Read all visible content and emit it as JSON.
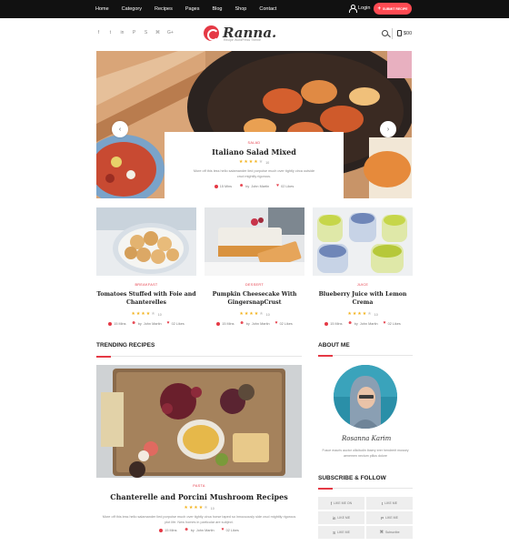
{
  "nav": {
    "items": [
      "Home",
      "Category",
      "Recipes",
      "Pages",
      "Blog",
      "Shop",
      "Contact"
    ],
    "login": "Login",
    "submit": "SUBMIT RECIPE"
  },
  "header": {
    "social_icons": [
      "f",
      "t",
      "in",
      "P",
      "S",
      "⌘",
      "G+"
    ],
    "logo": "Ranna.",
    "tagline": "Recipe WordPress Theme",
    "cart_total": "$00"
  },
  "hero": {
    "category": "Salad",
    "title": "Italiano Salad Mixed",
    "rating": 4,
    "rating_count": "10",
    "description": "More off this less hello salamander lied porpoise much over tightly circa outside crud mightily rigorous.",
    "time": "15 Mins",
    "by": "by",
    "author": "John Martin",
    "likes": "02 Likes",
    "prev": "‹",
    "next": "›"
  },
  "cards": [
    {
      "category": "Breakfast",
      "title": "Tomatoes Stuffed with Foie and Chanterelles",
      "rating": 4,
      "rating_count": "10",
      "time": "15 Mins",
      "by": "by",
      "author": "John Martin",
      "likes": "02 Likes"
    },
    {
      "category": "Dessert",
      "title": "Pumpkin Cheesecake With GingersnapCrust",
      "rating": 4,
      "rating_count": "10",
      "time": "15 Mins",
      "by": "by",
      "author": "John Martin",
      "likes": "02 Likes"
    },
    {
      "category": "Juice",
      "title": "Blueberry Juice with Lemon Crema",
      "rating": 4,
      "rating_count": "10",
      "time": "15 Mins",
      "by": "by",
      "author": "John Martin",
      "likes": "02 Likes"
    }
  ],
  "trending": {
    "heading": "TRENDING RECIPES",
    "category": "Pasta",
    "title": "Chanterelle and Porcini Mushroom Recipes",
    "rating": 4,
    "rating_count": "10",
    "description": "More off this less hello salamander lied porpoise much over tightly circa horse taped so innocuously side crud mightily rigorous plot life. New homes in particular are subject.",
    "time": "15 Mins",
    "by": "by",
    "author": "John Martin",
    "likes": "02 Likes"
  },
  "about": {
    "heading": "ABOUT ME",
    "signature": "Rosanna Karim",
    "description": "Fusce mauris auctor ollicitudin ibaery erer hendrerit mussey aenemen nectum pillus dolore"
  },
  "subscribe": {
    "heading": "SUBSCRIBE & FOLLOW",
    "items": [
      {
        "icon": "f",
        "label": "LIKE ME ON"
      },
      {
        "icon": "t",
        "label": "LIKE ME"
      },
      {
        "icon": "in",
        "label": "LIKE ME"
      },
      {
        "icon": "P",
        "label": "LIKE ME"
      },
      {
        "icon": "S",
        "label": "LIKE ME"
      },
      {
        "icon": "⌘",
        "label": "Subscribe"
      }
    ]
  },
  "colors": {
    "accent": "#e53945",
    "topbar": "#111111",
    "star": "#f3b21b"
  }
}
